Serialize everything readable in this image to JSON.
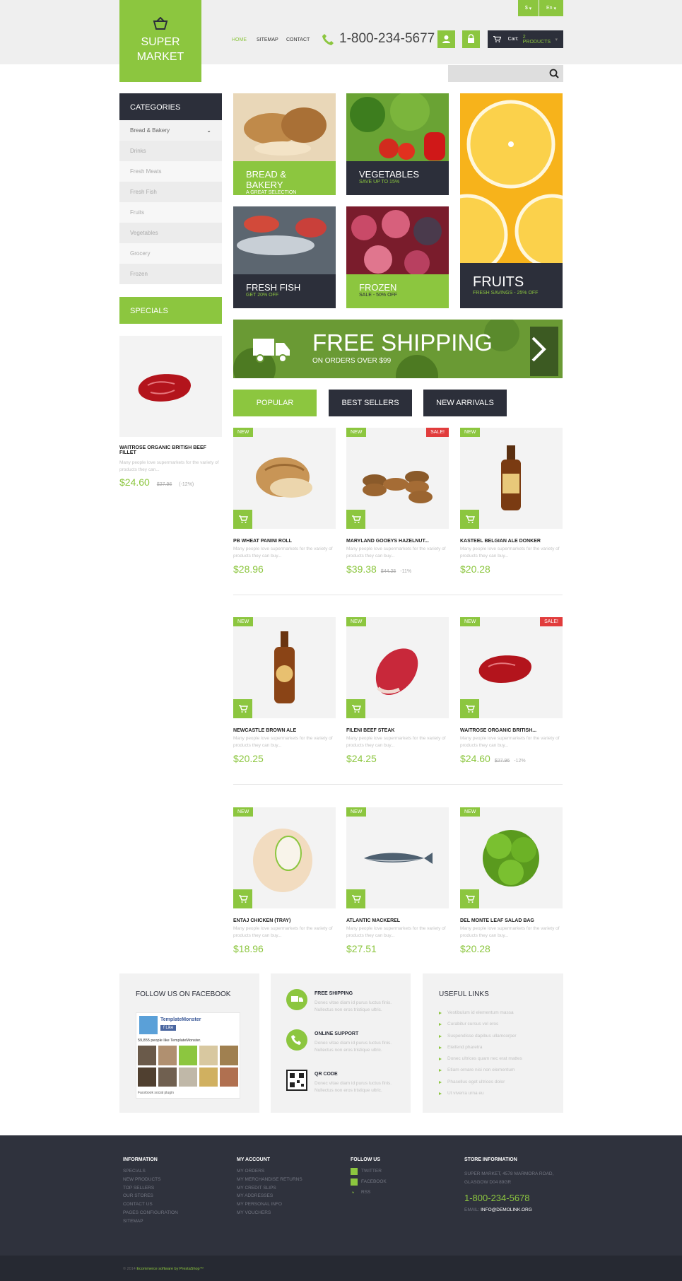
{
  "header": {
    "logo": {
      "line1": "SUPER",
      "line2": "MARKET"
    },
    "nav": [
      "HOME",
      "SITEMAP",
      "CONTACT"
    ],
    "phone": "1-800-234-5677",
    "cart_label": "Cart:",
    "cart_count": "2 PRODUCTS",
    "currency": "$",
    "language": "En",
    "accent": "#8cc63f",
    "dark": "#2c2f3a"
  },
  "sidebar": {
    "categories_title": "CATEGORIES",
    "categories": [
      "Bread & Bakery",
      "Drinks",
      "Fresh Meats",
      "Fresh Fish",
      "Fruits",
      "Vegetables",
      "Grocery",
      "Frozen"
    ],
    "specials_title": "SPECIALS",
    "special": {
      "name": "WAITROSE ORGANIC BRITISH BEEF FILLET",
      "desc": "Many people love supermarkets for the variety of products they can...",
      "price": "$24.60",
      "old_price": "$27.96",
      "reduction": "(-12%)"
    }
  },
  "tiles": [
    {
      "title": "BREAD & BAKERY",
      "sub": "A GREAT SELECTION"
    },
    {
      "title": "VEGETABLES",
      "sub": "SAVE UP TO 15%"
    },
    {
      "title": "FRUITS",
      "sub": "FRESH SAVINGS - 25% OFF"
    },
    {
      "title": "FRESH FISH",
      "sub": "GET 20% OFF"
    },
    {
      "title": "FROZEN",
      "sub": "SALE - 50% OFF"
    }
  ],
  "banner": {
    "title": "FREE SHIPPING",
    "sub": "ON ORDERS OVER $99"
  },
  "tabs": [
    "POPULAR",
    "BEST SELLERS",
    "NEW ARRIVALS"
  ],
  "products": [
    {
      "name": "PB WHEAT PANINI ROLL",
      "desc": "Many people love supermarkets for the variety of products they can buy...",
      "price": "$28.96",
      "old": "",
      "red": "",
      "badge": "NEW",
      "sale": ""
    },
    {
      "name": "MARYLAND GOOEYS HAZELNUT...",
      "desc": "Many people love supermarkets for the variety of products they can buy...",
      "price": "$39.38",
      "old": "$44.25",
      "red": "-11%",
      "badge": "NEW",
      "sale": "SALE!"
    },
    {
      "name": "KASTEEL BELGIAN ALE DONKER",
      "desc": "Many people love supermarkets for the variety of products they can buy...",
      "price": "$20.28",
      "old": "",
      "red": "",
      "badge": "NEW",
      "sale": ""
    },
    {
      "name": "NEWCASTLE BROWN ALE",
      "desc": "Many people love supermarkets for the variety of products they can buy...",
      "price": "$20.25",
      "old": "",
      "red": "",
      "badge": "NEW",
      "sale": ""
    },
    {
      "name": "FILENI BEEF STEAK",
      "desc": "Many people love supermarkets for the variety of products they can buy...",
      "price": "$24.25",
      "old": "",
      "red": "",
      "badge": "NEW",
      "sale": ""
    },
    {
      "name": "WAITROSE ORGANIC BRITISH...",
      "desc": "Many people love supermarkets for the variety of products they can buy...",
      "price": "$24.60",
      "old": "$27.96",
      "red": "-12%",
      "badge": "NEW",
      "sale": "SALE!"
    },
    {
      "name": "ENTAJ CHICKEN (TRAY)",
      "desc": "Many people love supermarkets for the variety of products they can buy...",
      "price": "$18.96",
      "old": "",
      "red": "",
      "badge": "NEW",
      "sale": ""
    },
    {
      "name": "ATLANTIC MACKEREL",
      "desc": "Many people love supermarkets for the variety of products they can buy...",
      "price": "$27.51",
      "old": "",
      "red": "",
      "badge": "NEW",
      "sale": ""
    },
    {
      "name": "DEL MONTE LEAF SALAD BAG",
      "desc": "Many people love supermarkets for the variety of products they can buy...",
      "price": "$20.28",
      "old": "",
      "red": "",
      "badge": "NEW",
      "sale": ""
    }
  ],
  "facebook": {
    "title": "FOLLOW US ON FACEBOOK",
    "page": "TemplateMonster",
    "like": "Like",
    "count": "59,855 people like TemplateMonster.",
    "plugin": "Facebook social plugin"
  },
  "features": [
    {
      "title": "FREE SHIPPING",
      "desc": "Donec vitae diam id purus luctus finis. Nullectus non eros tristique ultric."
    },
    {
      "title": "ONLINE SUPPORT",
      "desc": "Donec vitae diam id purus luctus finis. Nullectus non eros tristique ultric."
    },
    {
      "title": "QR CODE",
      "desc": "Donec vitae diam id purus luctus finis. Nullectus non eros tristique ultric."
    }
  ],
  "useful": {
    "title": "USEFUL LINKS",
    "links": [
      "Vestibulum id elementum massa",
      "Curabitur cursus vel eros",
      "Suspendisse dapibus ullamcorper",
      "Eleifend pharetra",
      "Donec ultrices quam nec erat mattes",
      "Etiam ornare nisi non elementum",
      "Phasellus eget ultrices dolor",
      "Ut viverra urna eu"
    ]
  },
  "footer": {
    "information": {
      "title": "INFORMATION",
      "items": [
        "SPECIALS",
        "NEW PRODUCTS",
        "TOP SELLERS",
        "OUR STORES",
        "CONTACT US",
        "PAGES CONFIGURATION",
        "SITEMAP"
      ]
    },
    "account": {
      "title": "MY ACCOUNT",
      "items": [
        "MY ORDERS",
        "MY MERCHANDISE RETURNS",
        "MY CREDIT SLIPS",
        "MY ADDRESSES",
        "MY PERSONAL INFO",
        "MY VOUCHERS"
      ]
    },
    "follow": {
      "title": "FOLLOW US",
      "items": [
        "TWITTER",
        "FACEBOOK",
        "RSS"
      ]
    },
    "store": {
      "title": "STORE INFORMATION",
      "address1": "SUPER MARKET, 4578 MARMORA ROAD,",
      "address2": "GLASGOW D04 89GR",
      "phone": "1-800-234-5678",
      "email_label": "EMAIL:",
      "email": "INFO@DEMOLINK.ORG"
    },
    "copyright": "© 2014",
    "powered": "Ecommerce software by PrestaShop™"
  }
}
